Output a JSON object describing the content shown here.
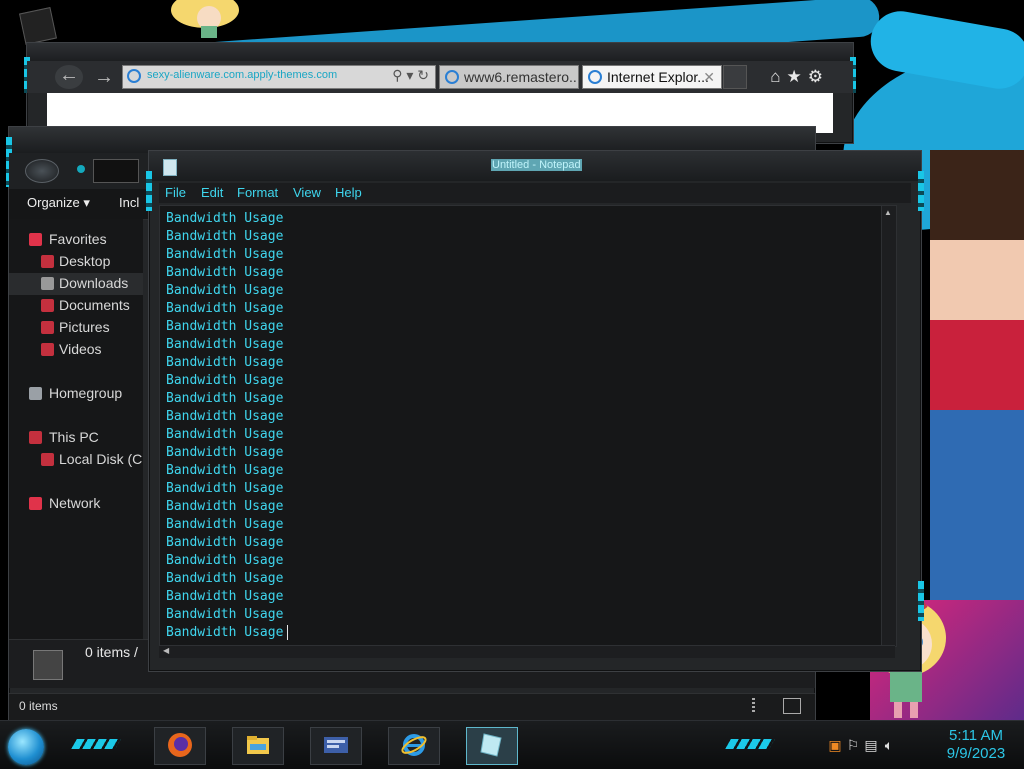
{
  "ie": {
    "address_url": "sexy-alienware.com.apply-themes.com",
    "tabs": [
      {
        "label": "www6.remastero...",
        "active": false
      },
      {
        "label": "Internet Explor...",
        "active": true
      }
    ],
    "tab_close": "✕",
    "icons": [
      "home-icon",
      "favorites-star-icon",
      "gear-icon"
    ]
  },
  "explorer": {
    "command_bar": {
      "organize": "Organize ▾",
      "include": "Incl"
    },
    "nav": [
      {
        "label": "Favorites",
        "level": 0,
        "icon": "favorites-icon",
        "color": "#e0334a"
      },
      {
        "label": "Desktop",
        "level": 1,
        "icon": "desktop-icon",
        "color": "#c4303e"
      },
      {
        "label": "Downloads",
        "level": 1,
        "icon": "downloads-icon",
        "color": "#999999",
        "selected": true
      },
      {
        "label": "Documents",
        "level": 1,
        "icon": "documents-icon",
        "color": "#c4303e"
      },
      {
        "label": "Pictures",
        "level": 1,
        "icon": "pictures-icon",
        "color": "#c4303e"
      },
      {
        "label": "Videos",
        "level": 1,
        "icon": "videos-icon",
        "color": "#c4303e"
      },
      {
        "label": "Homegroup",
        "level": 0,
        "icon": "homegroup-icon",
        "color": "#9aa0a6"
      },
      {
        "label": "This PC",
        "level": 0,
        "icon": "this-pc-icon",
        "color": "#c4303e"
      },
      {
        "label": "Local Disk (C:",
        "level": 1,
        "icon": "local-disk-icon",
        "color": "#c4303e"
      },
      {
        "label": "Network",
        "level": 0,
        "icon": "network-icon",
        "color": "#e0334a"
      }
    ],
    "details_count": "0 items /",
    "status_text": "0 items"
  },
  "notepad": {
    "title": "Untitled - Notepad",
    "menu": [
      "File",
      "Edit",
      "Format",
      "View",
      "Help"
    ],
    "lines": [
      "Bandwidth Usage",
      "Bandwidth Usage",
      "Bandwidth Usage",
      "Bandwidth Usage",
      "Bandwidth Usage",
      "Bandwidth Usage",
      "Bandwidth Usage",
      "Bandwidth Usage",
      "Bandwidth Usage",
      "Bandwidth Usage",
      "Bandwidth Usage",
      "Bandwidth Usage",
      "Bandwidth Usage",
      "Bandwidth Usage",
      "Bandwidth Usage",
      "Bandwidth Usage",
      "Bandwidth Usage",
      "Bandwidth Usage",
      "Bandwidth Usage",
      "Bandwidth Usage",
      "Bandwidth Usage",
      "Bandwidth Usage",
      "Bandwidth Usage",
      "Bandwidth Usage"
    ],
    "text_color": "#3fd6ee"
  },
  "taskbar": {
    "apps": [
      "firefox-icon",
      "file-explorer-icon",
      "control-panel-icon",
      "internet-explorer-icon",
      "notepad-icon"
    ],
    "tray_icons": [
      "sublime-icon",
      "flag-icon",
      "network-tray-icon",
      "volume-icon"
    ],
    "time": "5:11 AM",
    "date": "9/9/2023"
  },
  "colors": {
    "accent": "#19c6e6",
    "frame": "#242628"
  }
}
